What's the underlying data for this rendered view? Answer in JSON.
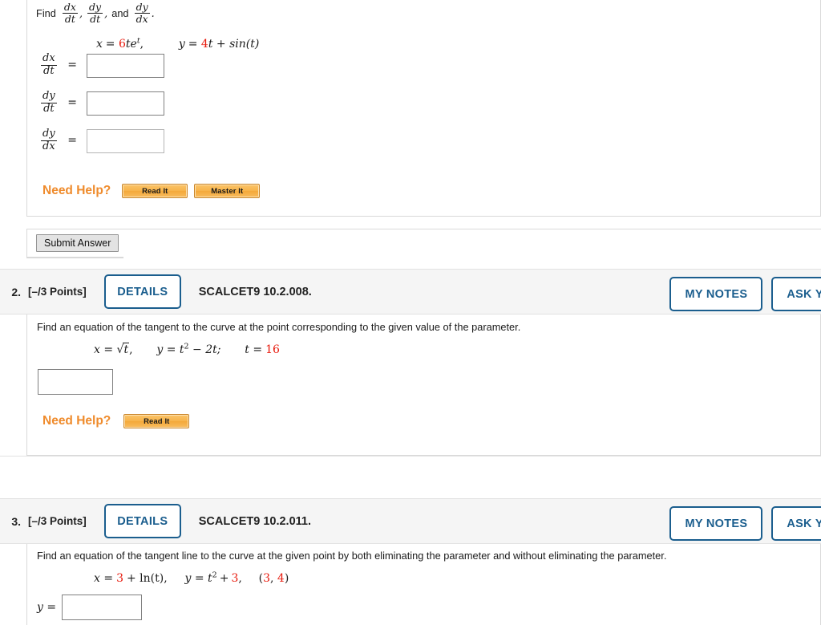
{
  "questions": [
    {
      "number": "",
      "points": "",
      "details_label": "",
      "code": "",
      "my_notes_label": "",
      "ask_label": "",
      "prompt_prefix": "Find",
      "prompt_suffix": ".",
      "eq_x_label": "x",
      "eq_x_coef": "6",
      "eq_x_rest": "te",
      "eq_x_exp": "t",
      "eq_y_label": "y",
      "eq_y_coef": "4",
      "eq_y_rest": "t + sin(t)",
      "answer_rows": [
        {
          "label_num": "dx",
          "label_den": "dt",
          "value": "",
          "placeholder": ""
        },
        {
          "label_num": "dy",
          "label_den": "dt",
          "value": "",
          "placeholder": ""
        },
        {
          "label_num": "dy",
          "label_den": "dx",
          "value": "",
          "placeholder": ""
        }
      ],
      "need_help_label": "Need Help?",
      "read_it_label": "Read It",
      "master_it_label": "Master It",
      "submit_label": "Submit Answer"
    },
    {
      "number": "2.",
      "points": "[–/3 Points]",
      "details_label": "DETAILS",
      "code": "SCALCET9 10.2.008.",
      "my_notes_label": "MY NOTES",
      "ask_label": "ASK YOUR",
      "prompt": "Find an equation of the tangent to the curve at the point corresponding to the given value of the parameter.",
      "eq_x": "x = √t,",
      "eq_y_base": "y = t",
      "eq_y_exp": "2",
      "eq_y_rest": " − 2t;",
      "eq_t_label": "t =",
      "eq_t_value": "16",
      "answer_value": "",
      "need_help_label": "Need Help?",
      "read_it_label": "Read It"
    },
    {
      "number": "3.",
      "points": "[–/3 Points]",
      "details_label": "DETAILS",
      "code": "SCALCET9 10.2.011.",
      "my_notes_label": "MY NOTES",
      "ask_label": "ASK YOUR",
      "prompt": "Find an equation of the tangent line to the curve at the given point by both eliminating the parameter and without eliminating the parameter.",
      "eq_x_label": "x =",
      "eq_x_const": "3",
      "eq_x_rest": "+ ln(t),",
      "eq_y_label": "y = t",
      "eq_y_exp": "2",
      "eq_y_plus": "+",
      "eq_y_const": "3",
      "eq_y_comma": ",",
      "point_open": "(",
      "point_x": "3",
      "point_sep": ", ",
      "point_y": "4",
      "point_close": ")",
      "answer_label": "y =",
      "answer_value": ""
    }
  ],
  "colors": {
    "accent_blue": "#1b5e8e",
    "help_orange": "#ef8b2c",
    "math_red": "#e8190c",
    "header_bg": "#f5f5f5",
    "border_gray": "#d9d9d9"
  }
}
